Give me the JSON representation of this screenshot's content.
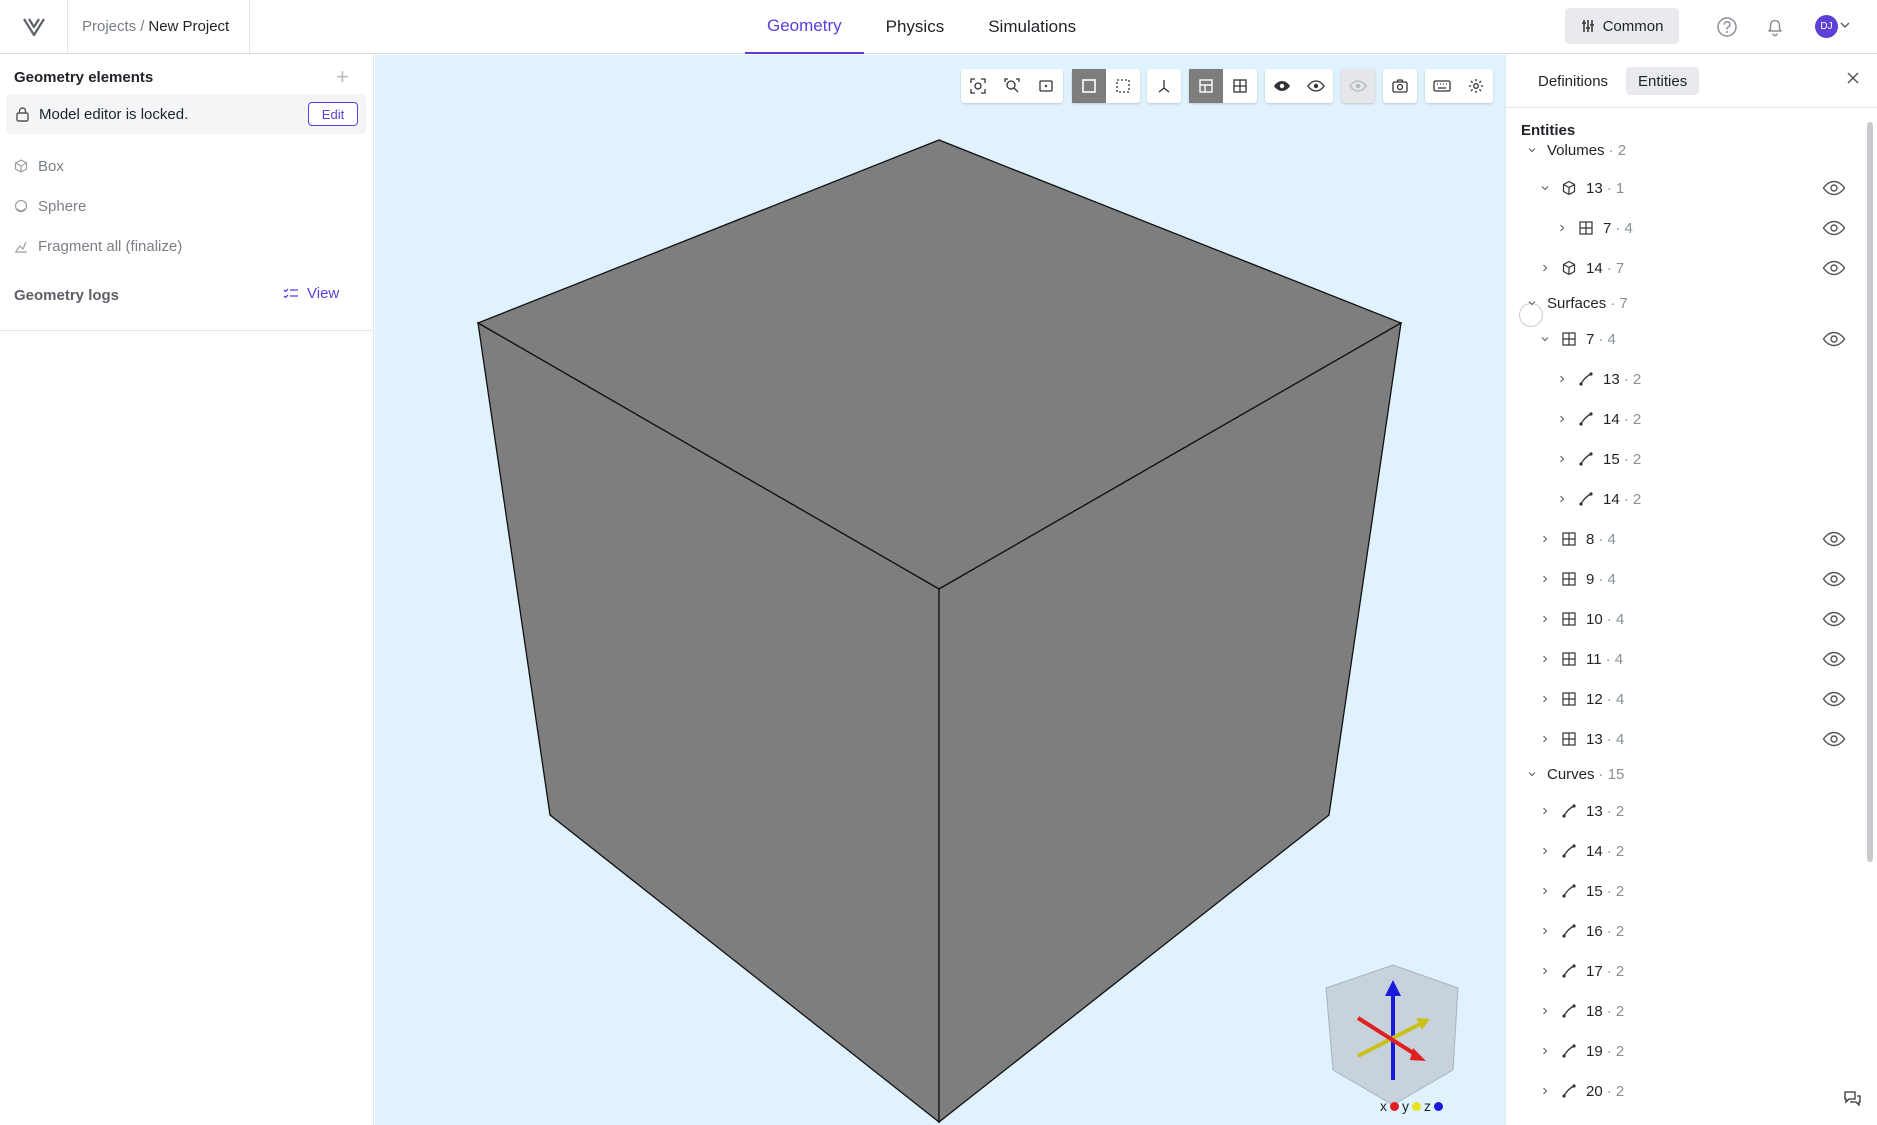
{
  "header": {
    "breadcrumb_root": "Projects",
    "breadcrumb_sep": "/",
    "breadcrumb_current": "New Project",
    "tabs": [
      "Geometry",
      "Physics",
      "Simulations"
    ],
    "active_tab": "Geometry",
    "workspace_button": "Common",
    "avatar_initials": "DJ"
  },
  "left_panel": {
    "title": "Geometry elements",
    "locked_text": "Model editor is locked.",
    "edit_label": "Edit",
    "items": [
      "Box",
      "Sphere",
      "Fragment all (finalize)"
    ],
    "logs_title": "Geometry logs",
    "view_label": "View"
  },
  "right_panel": {
    "tabs": [
      "Definitions",
      "Entities"
    ],
    "active_tab": "Entities",
    "title": "Entities",
    "tree": [
      {
        "label": "Volumes",
        "count": "2"
      },
      {
        "label": "13",
        "count": "1"
      },
      {
        "label": "7",
        "count": "4"
      },
      {
        "label": "14",
        "count": "7"
      },
      {
        "label": "Surfaces",
        "count": "7"
      },
      {
        "label": "7",
        "count": "4"
      },
      {
        "label": "13",
        "count": "2"
      },
      {
        "label": "14",
        "count": "2"
      },
      {
        "label": "15",
        "count": "2"
      },
      {
        "label": "14",
        "count": "2"
      },
      {
        "label": "8",
        "count": "4"
      },
      {
        "label": "9",
        "count": "4"
      },
      {
        "label": "10",
        "count": "4"
      },
      {
        "label": "11",
        "count": "4"
      },
      {
        "label": "12",
        "count": "4"
      },
      {
        "label": "13",
        "count": "4"
      },
      {
        "label": "Curves",
        "count": "15"
      },
      {
        "label": "13",
        "count": "2"
      },
      {
        "label": "14",
        "count": "2"
      },
      {
        "label": "15",
        "count": "2"
      },
      {
        "label": "16",
        "count": "2"
      },
      {
        "label": "17",
        "count": "2"
      },
      {
        "label": "18",
        "count": "2"
      },
      {
        "label": "19",
        "count": "2"
      },
      {
        "label": "20",
        "count": "2"
      }
    ]
  },
  "viewport": {
    "axis_labels": [
      "x",
      "y",
      "z"
    ],
    "axis_colors": [
      "#e02020",
      "#e8e020",
      "#1a1adf"
    ],
    "background": "#e0f2fd",
    "cube_color": "#7e7e7e"
  }
}
